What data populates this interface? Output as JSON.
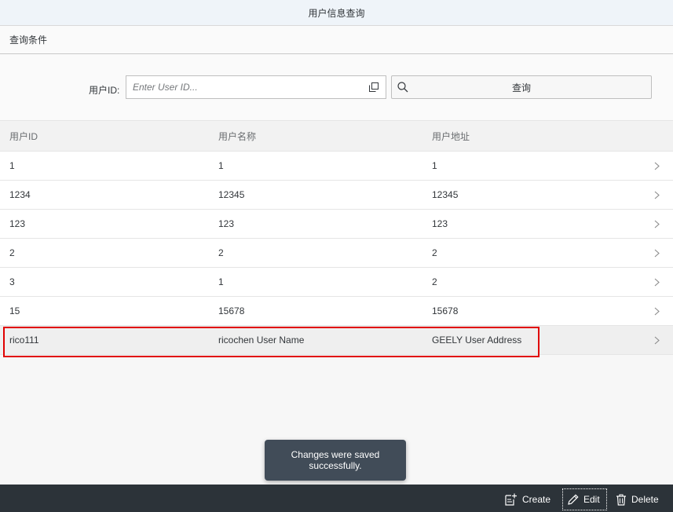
{
  "app": {
    "title": "用户信息查询"
  },
  "filter": {
    "section_title": "查询条件",
    "label": "用户ID:",
    "input_placeholder": "Enter User ID...",
    "search_label": "查询"
  },
  "table": {
    "columns": [
      "用户ID",
      "用户名称",
      "用户地址"
    ],
    "rows": [
      [
        "1",
        "1",
        "1"
      ],
      [
        "1234",
        "12345",
        "12345"
      ],
      [
        "123",
        "123",
        "123"
      ],
      [
        "2",
        "2",
        "2"
      ],
      [
        "3",
        "1",
        "2"
      ],
      [
        "15",
        "15678",
        "15678"
      ],
      [
        "rico111",
        "ricochen User Name",
        "GEELY User Address"
      ]
    ]
  },
  "toast": {
    "message": "Changes were saved successfully."
  },
  "footer": {
    "create_label": "Create",
    "edit_label": "Edit",
    "delete_label": "Delete"
  },
  "icons": {
    "value_help": "value-help-icon",
    "search": "search-icon",
    "row_nav": "chevron-right-icon",
    "create": "create-icon",
    "edit": "pencil-icon",
    "delete": "trash-icon"
  },
  "colors": {
    "footer_bg": "#2c3339",
    "toast_bg": "#414c58",
    "highlight": "#e00000"
  }
}
